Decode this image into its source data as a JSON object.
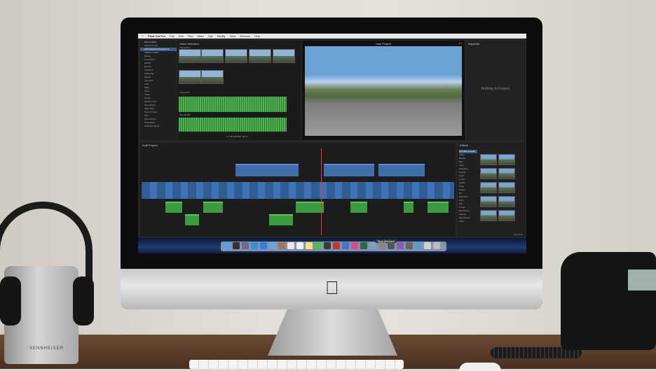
{
  "menubar": {
    "app_name": "Final Cut Pro",
    "items": [
      "File",
      "Edit",
      "Trim",
      "Mark",
      "Clip",
      "Modify",
      "View",
      "Window",
      "Help"
    ]
  },
  "library": {
    "title": "Event Library",
    "rows": [
      "Macintosh HD",
      "Audi Sportscar Experience",
      "AERIAL AUDIO",
      "Beauty",
      "Car Interior",
      "DRIVE",
      "Exterior",
      "Graphics",
      "Helicopter",
      "Interior",
      "Interview",
      "Audi",
      "Rally",
      "Race",
      "Track",
      "People",
      "Medium Shot",
      "Slow Motion",
      "Wide Shot",
      "Point of View",
      "SFX",
      "Slow Motion",
      "Duplication",
      "Exclusive Shots"
    ],
    "selected_index": 1
  },
  "browser": {
    "title": "Video Selection",
    "date1": "5 Aug 2011",
    "date2": "4 Aug 2011",
    "sub_label": "Internal Mic",
    "status": "1 of 58 selected, 00:12"
  },
  "viewer": {
    "title": "Audi Project",
    "zoom": "8%",
    "panel_label": "Audi Test Run"
  },
  "inspector": {
    "title": "Inspector",
    "empty_text": "Nothing to Inspect"
  },
  "timeline": {
    "title": "Audi Project"
  },
  "effects": {
    "title": "Effects",
    "header": "All Video & Audio",
    "categories": [
      "Video",
      "Basics",
      "Blur",
      "Color",
      "Distortion",
      "Keying",
      "Light",
      "Looks",
      "Stylize",
      "Tiling",
      "Audio",
      "All",
      "Distortion",
      "Echo",
      "EQ",
      "Levels",
      "Modulation",
      "Spaces",
      "Specialized",
      "Voice"
    ],
    "item_count": "142 items"
  },
  "dock": {
    "hover_label": "Time Machine",
    "icons": [
      "finder-icon",
      "dashboard-icon",
      "mission-control-icon",
      "safari-icon",
      "app-store-icon",
      "mail-icon",
      "contacts-icon",
      "calendar-icon",
      "reminders-icon",
      "notes-icon",
      "messages-icon",
      "facetime-icon",
      "photo-booth-icon",
      "iphoto-icon",
      "itunes-icon",
      "time-machine-icon",
      "preview-icon",
      "system-preferences-icon",
      "final-cut-pro-icon",
      "motion-icon",
      "compressor-icon",
      "folder-icon",
      "documents-icon",
      "trash-icon"
    ]
  },
  "headphone_brand": "SENNHEISER",
  "colors": {
    "accent": "#3a5c8e",
    "clip_blue": "#3d74b8",
    "clip_green": "#3c9a3f",
    "playhead": "#ee3333"
  }
}
